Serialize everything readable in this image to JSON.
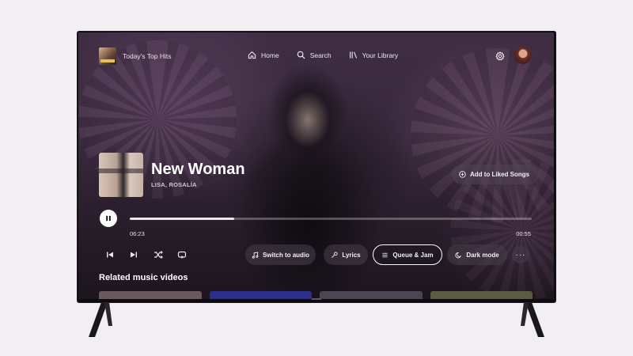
{
  "header": {
    "playlist_title": "Today's Top Hits",
    "nav": [
      {
        "label": "Home",
        "icon": "home-icon"
      },
      {
        "label": "Search",
        "icon": "search-icon"
      },
      {
        "label": "Your Library",
        "icon": "library-icon"
      }
    ],
    "settings_icon": "gear-icon"
  },
  "track": {
    "title": "New Woman",
    "artist": "LISA, ROSALÍA",
    "add_label": "Add to Liked Songs"
  },
  "playback": {
    "elapsed": "06:23",
    "remaining": "00:55",
    "progress_fraction": 0.26
  },
  "controls": {
    "switch_to_audio": "Switch to audio",
    "lyrics": "Lyrics",
    "queue_jam": "Queue & Jam",
    "dark_mode": "Dark mode",
    "more": "···"
  },
  "related": {
    "title": "Related music videos",
    "thumb_colors": [
      "#6a5a60",
      "#2b2f8c",
      "#4a4652",
      "#5d5a44"
    ]
  },
  "colors": {
    "accent": "#ffffff",
    "screen_bg": "#3a2a3e"
  }
}
